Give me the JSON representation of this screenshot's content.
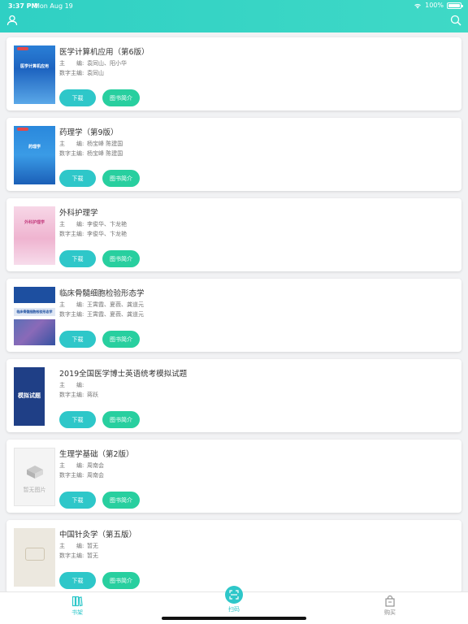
{
  "status": {
    "time": "3:37 PM",
    "date": "Mon Aug 19",
    "battery": "100%"
  },
  "header": {
    "left_icon": "user-icon",
    "right_icon": "search-icon"
  },
  "labels": {
    "editor_key": "主　　编:",
    "digital_editor_key": "数字主编:",
    "download": "下载",
    "intro": "图书简介",
    "no_image": "暂无图片"
  },
  "books": [
    {
      "title": "医学计算机应用（第6版）",
      "editor": "袁同山、阳小华",
      "digital_editor": "袁同山",
      "cover_text": "医学计算机应用"
    },
    {
      "title": "药理学（第9版）",
      "editor": "杨宝峰 陈建国",
      "digital_editor": "杨宝峰 陈建国",
      "cover_text": "药理学"
    },
    {
      "title": "外科护理学",
      "editor": "李俊华、卞龙艳",
      "digital_editor": "李俊华、卞龙艳",
      "cover_text": "外科护理学"
    },
    {
      "title": "临床骨髓细胞检验形态学",
      "editor": "王霄霞、夏薇、龚道元",
      "digital_editor": "王霄霞、夏薇、龚道元",
      "cover_text": "临床骨髓细胞检验形态学"
    },
    {
      "title": "2019全国医学博士英语统考模拟试题",
      "editor": "",
      "digital_editor": "蒋跃",
      "cover_text": "模拟试题"
    },
    {
      "title": "生理学基础（第2版）",
      "editor": "周南会",
      "digital_editor": "周南会",
      "cover_text": ""
    },
    {
      "title": "中国针灸学（第五版）",
      "editor": "暂无",
      "digital_editor": "暂无",
      "cover_text": ""
    }
  ],
  "tabbar": {
    "items": [
      {
        "label": "书架",
        "icon": "bookshelf-icon",
        "active": true
      },
      {
        "label": "扫码",
        "icon": "scan-icon",
        "active": false
      },
      {
        "label": "购买",
        "icon": "shopping-bag-icon",
        "active": false
      }
    ]
  },
  "colors": {
    "accent": "#2ec7c9",
    "intro_button": "#28cf9f",
    "header": "#38d4c5"
  }
}
